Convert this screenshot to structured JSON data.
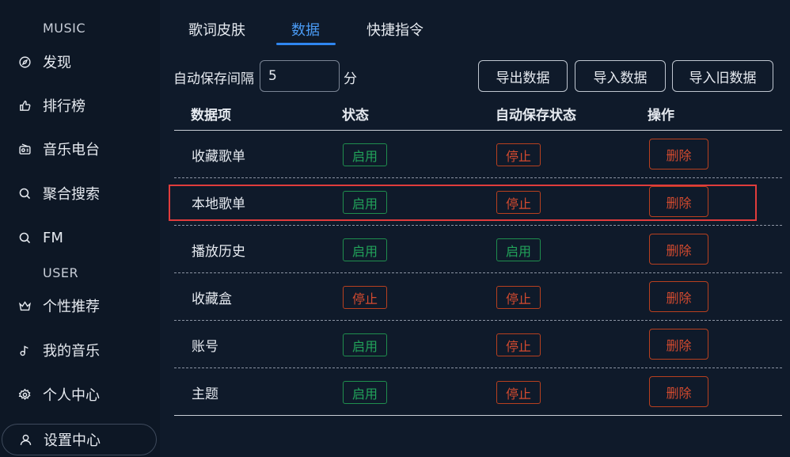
{
  "sidebar": {
    "music_section": "MUSIC",
    "user_section": "USER",
    "items": [
      {
        "label": "发现",
        "icon": "compass-icon"
      },
      {
        "label": "排行榜",
        "icon": "thumbs-up-icon"
      },
      {
        "label": "音乐电台",
        "icon": "radio-icon"
      },
      {
        "label": "聚合搜索",
        "icon": "search-icon"
      },
      {
        "label": "FM",
        "icon": "search-icon"
      },
      {
        "label": "个性推荐",
        "icon": "crown-icon"
      },
      {
        "label": "我的音乐",
        "icon": "music-note-icon"
      },
      {
        "label": "个人中心",
        "icon": "gear-icon"
      },
      {
        "label": "设置中心",
        "icon": "user-icon"
      }
    ]
  },
  "tabs": [
    {
      "label": "歌词皮肤"
    },
    {
      "label": "数据"
    },
    {
      "label": "快捷指令"
    }
  ],
  "toolbar": {
    "interval_label": "自动保存间隔",
    "interval_value": "5",
    "interval_unit": "分",
    "export_label": "导出数据",
    "import_label": "导入数据",
    "import_old_label": "导入旧数据"
  },
  "table": {
    "headers": [
      "数据项",
      "状态",
      "自动保存状态",
      "操作"
    ],
    "rows": [
      {
        "name": "收藏歌单",
        "status": "启用",
        "auto_save": "停止",
        "action": "删除"
      },
      {
        "name": "本地歌单",
        "status": "启用",
        "auto_save": "停止",
        "action": "删除"
      },
      {
        "name": "播放历史",
        "status": "启用",
        "auto_save": "启用",
        "action": "删除"
      },
      {
        "name": "收藏盒",
        "status": "停止",
        "auto_save": "停止",
        "action": "删除"
      },
      {
        "name": "账号",
        "status": "启用",
        "auto_save": "停止",
        "action": "删除"
      },
      {
        "name": "主题",
        "status": "启用",
        "auto_save": "停止",
        "action": "删除"
      }
    ]
  },
  "colors": {
    "background": "#0f1a2a",
    "accent": "#2f86f0",
    "enabled": "#22a35a",
    "stopped": "#d24a2f",
    "highlight": "#e03c3c"
  }
}
